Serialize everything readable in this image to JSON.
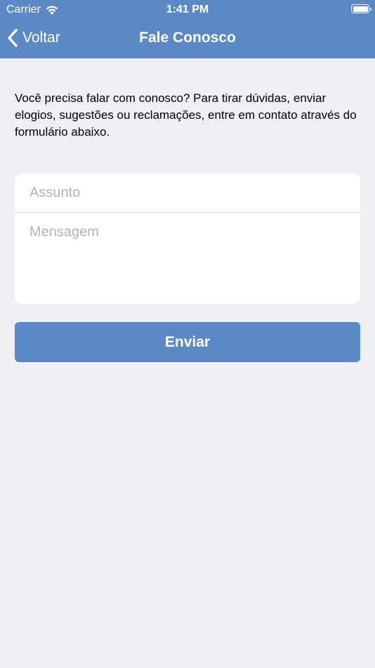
{
  "status_bar": {
    "carrier": "Carrier",
    "time": "1:41 PM",
    "wifi_icon": "wifi-icon",
    "battery_icon": "battery-icon"
  },
  "nav": {
    "back_label": "Voltar",
    "back_icon": "chevron-left-icon",
    "title": "Fale Conosco"
  },
  "intro_text": "Você precisa falar com conosco? Para tirar dúvidas, enviar elogios, sugestões ou reclamações, entre em contato através do formulário abaixo.",
  "form": {
    "subject_placeholder": "Assunto",
    "subject_value": "",
    "message_placeholder": "Mensagem",
    "message_value": ""
  },
  "send_button_label": "Enviar",
  "colors": {
    "accent": "#5b89c6",
    "background": "#efeff4",
    "card": "#ffffff",
    "placeholder": "#b3b3b8"
  }
}
